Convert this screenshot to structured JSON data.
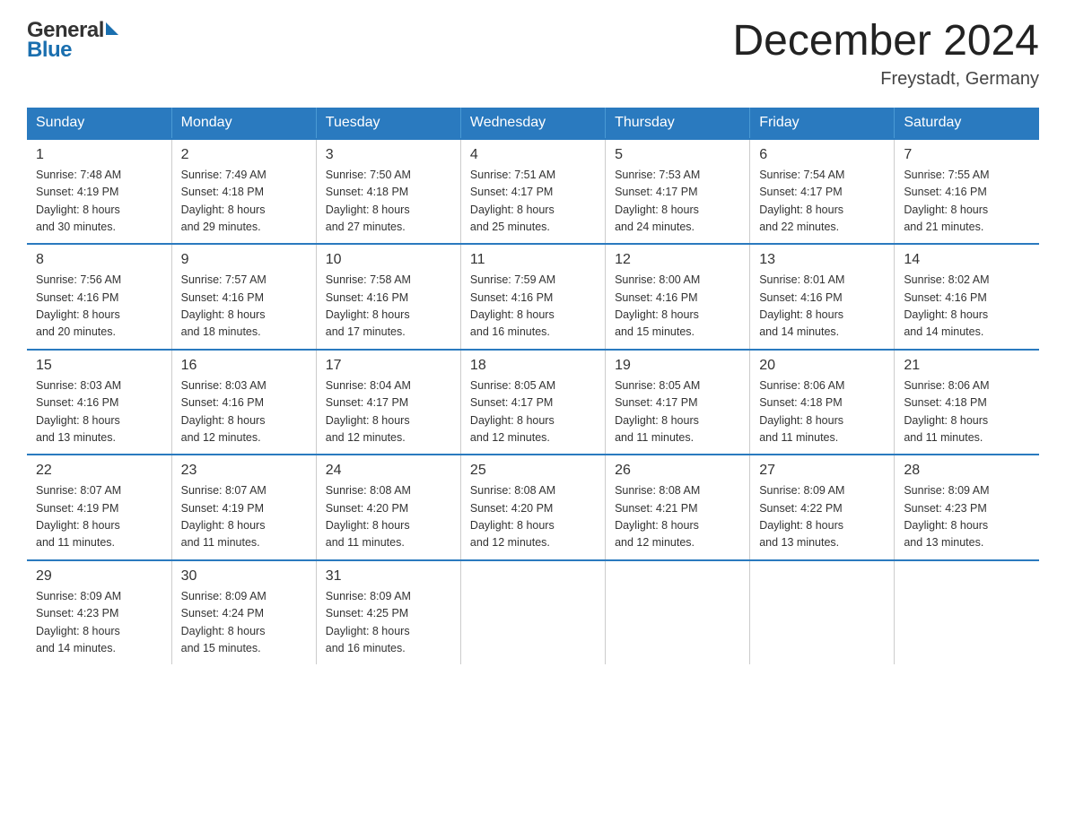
{
  "header": {
    "logo_general": "General",
    "logo_blue": "Blue",
    "title": "December 2024",
    "location": "Freystadt, Germany"
  },
  "calendar": {
    "days_of_week": [
      "Sunday",
      "Monday",
      "Tuesday",
      "Wednesday",
      "Thursday",
      "Friday",
      "Saturday"
    ],
    "weeks": [
      [
        {
          "day": "1",
          "sunrise": "7:48 AM",
          "sunset": "4:19 PM",
          "daylight": "8 hours and 30 minutes."
        },
        {
          "day": "2",
          "sunrise": "7:49 AM",
          "sunset": "4:18 PM",
          "daylight": "8 hours and 29 minutes."
        },
        {
          "day": "3",
          "sunrise": "7:50 AM",
          "sunset": "4:18 PM",
          "daylight": "8 hours and 27 minutes."
        },
        {
          "day": "4",
          "sunrise": "7:51 AM",
          "sunset": "4:17 PM",
          "daylight": "8 hours and 25 minutes."
        },
        {
          "day": "5",
          "sunrise": "7:53 AM",
          "sunset": "4:17 PM",
          "daylight": "8 hours and 24 minutes."
        },
        {
          "day": "6",
          "sunrise": "7:54 AM",
          "sunset": "4:17 PM",
          "daylight": "8 hours and 22 minutes."
        },
        {
          "day": "7",
          "sunrise": "7:55 AM",
          "sunset": "4:16 PM",
          "daylight": "8 hours and 21 minutes."
        }
      ],
      [
        {
          "day": "8",
          "sunrise": "7:56 AM",
          "sunset": "4:16 PM",
          "daylight": "8 hours and 20 minutes."
        },
        {
          "day": "9",
          "sunrise": "7:57 AM",
          "sunset": "4:16 PM",
          "daylight": "8 hours and 18 minutes."
        },
        {
          "day": "10",
          "sunrise": "7:58 AM",
          "sunset": "4:16 PM",
          "daylight": "8 hours and 17 minutes."
        },
        {
          "day": "11",
          "sunrise": "7:59 AM",
          "sunset": "4:16 PM",
          "daylight": "8 hours and 16 minutes."
        },
        {
          "day": "12",
          "sunrise": "8:00 AM",
          "sunset": "4:16 PM",
          "daylight": "8 hours and 15 minutes."
        },
        {
          "day": "13",
          "sunrise": "8:01 AM",
          "sunset": "4:16 PM",
          "daylight": "8 hours and 14 minutes."
        },
        {
          "day": "14",
          "sunrise": "8:02 AM",
          "sunset": "4:16 PM",
          "daylight": "8 hours and 14 minutes."
        }
      ],
      [
        {
          "day": "15",
          "sunrise": "8:03 AM",
          "sunset": "4:16 PM",
          "daylight": "8 hours and 13 minutes."
        },
        {
          "day": "16",
          "sunrise": "8:03 AM",
          "sunset": "4:16 PM",
          "daylight": "8 hours and 12 minutes."
        },
        {
          "day": "17",
          "sunrise": "8:04 AM",
          "sunset": "4:17 PM",
          "daylight": "8 hours and 12 minutes."
        },
        {
          "day": "18",
          "sunrise": "8:05 AM",
          "sunset": "4:17 PM",
          "daylight": "8 hours and 12 minutes."
        },
        {
          "day": "19",
          "sunrise": "8:05 AM",
          "sunset": "4:17 PM",
          "daylight": "8 hours and 11 minutes."
        },
        {
          "day": "20",
          "sunrise": "8:06 AM",
          "sunset": "4:18 PM",
          "daylight": "8 hours and 11 minutes."
        },
        {
          "day": "21",
          "sunrise": "8:06 AM",
          "sunset": "4:18 PM",
          "daylight": "8 hours and 11 minutes."
        }
      ],
      [
        {
          "day": "22",
          "sunrise": "8:07 AM",
          "sunset": "4:19 PM",
          "daylight": "8 hours and 11 minutes."
        },
        {
          "day": "23",
          "sunrise": "8:07 AM",
          "sunset": "4:19 PM",
          "daylight": "8 hours and 11 minutes."
        },
        {
          "day": "24",
          "sunrise": "8:08 AM",
          "sunset": "4:20 PM",
          "daylight": "8 hours and 11 minutes."
        },
        {
          "day": "25",
          "sunrise": "8:08 AM",
          "sunset": "4:20 PM",
          "daylight": "8 hours and 12 minutes."
        },
        {
          "day": "26",
          "sunrise": "8:08 AM",
          "sunset": "4:21 PM",
          "daylight": "8 hours and 12 minutes."
        },
        {
          "day": "27",
          "sunrise": "8:09 AM",
          "sunset": "4:22 PM",
          "daylight": "8 hours and 13 minutes."
        },
        {
          "day": "28",
          "sunrise": "8:09 AM",
          "sunset": "4:23 PM",
          "daylight": "8 hours and 13 minutes."
        }
      ],
      [
        {
          "day": "29",
          "sunrise": "8:09 AM",
          "sunset": "4:23 PM",
          "daylight": "8 hours and 14 minutes."
        },
        {
          "day": "30",
          "sunrise": "8:09 AM",
          "sunset": "4:24 PM",
          "daylight": "8 hours and 15 minutes."
        },
        {
          "day": "31",
          "sunrise": "8:09 AM",
          "sunset": "4:25 PM",
          "daylight": "8 hours and 16 minutes."
        },
        null,
        null,
        null,
        null
      ]
    ],
    "labels": {
      "sunrise": "Sunrise:",
      "sunset": "Sunset:",
      "daylight": "Daylight:"
    }
  }
}
